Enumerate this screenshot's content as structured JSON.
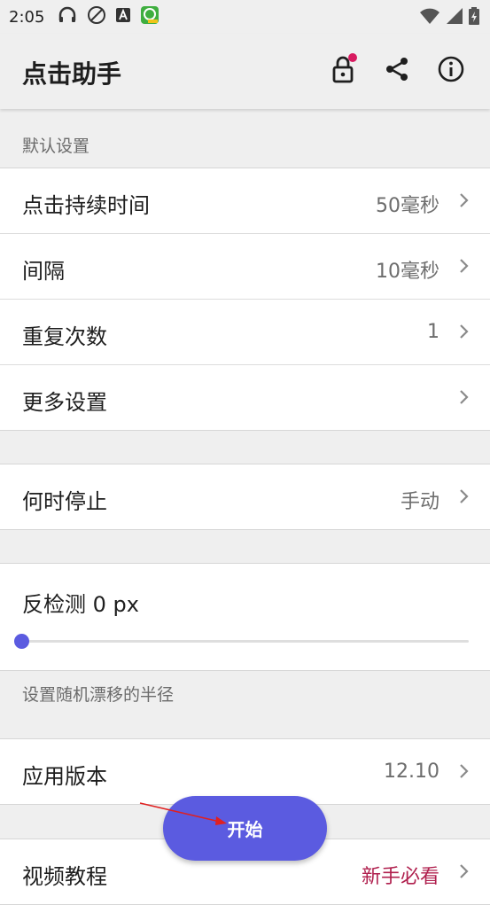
{
  "status_bar": {
    "time": "2:05"
  },
  "app_bar": {
    "title": "点击助手"
  },
  "sections": {
    "default_settings": {
      "header": "默认设置",
      "rows": [
        {
          "label": "点击持续时间",
          "value": "50毫秒"
        },
        {
          "label": "间隔",
          "value": "10毫秒"
        },
        {
          "label": "重复次数",
          "value": "1"
        },
        {
          "label": "更多设置",
          "value": ""
        }
      ]
    },
    "stop": {
      "label": "何时停止",
      "value": "手动"
    },
    "anti_detect": {
      "label": "反检测 0 px",
      "slider_level": 0,
      "hint": "设置随机漂移的半径"
    },
    "version": {
      "label": "应用版本",
      "value": "12.10"
    },
    "tutorial": {
      "label": "视频教程",
      "value": "新手必看"
    }
  },
  "fab": {
    "label": "开始"
  },
  "colors": {
    "accent": "#5b5be0",
    "badge": "#d81b60",
    "tutorial_value": "#b0204e"
  }
}
